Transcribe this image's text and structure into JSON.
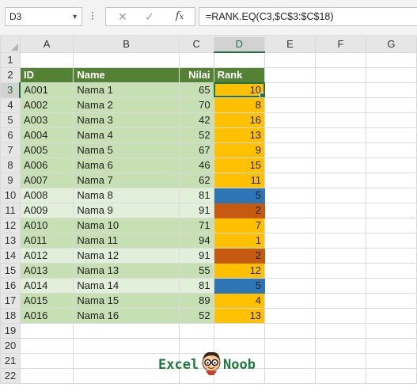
{
  "name_box": "D3",
  "formula": "=RANK.EQ(C3,$C$3:$C$18)",
  "fx_label": "fx",
  "columns": [
    "A",
    "B",
    "C",
    "D",
    "E",
    "F",
    "G"
  ],
  "active_cell": "D3",
  "table": {
    "headers": [
      "ID",
      "Name",
      "Nilai",
      "Rank"
    ],
    "rows": [
      {
        "id": "A001",
        "name": "Nama 1",
        "nilai": "65",
        "rank": "10",
        "rank_color": "yellow",
        "band": "g1"
      },
      {
        "id": "A002",
        "name": "Nama 2",
        "nilai": "70",
        "rank": "8",
        "rank_color": "yellow",
        "band": "g1"
      },
      {
        "id": "A003",
        "name": "Nama 3",
        "nilai": "42",
        "rank": "16",
        "rank_color": "yellow",
        "band": "g1"
      },
      {
        "id": "A004",
        "name": "Nama 4",
        "nilai": "52",
        "rank": "13",
        "rank_color": "yellow",
        "band": "g1"
      },
      {
        "id": "A005",
        "name": "Nama 5",
        "nilai": "67",
        "rank": "9",
        "rank_color": "yellow",
        "band": "g1"
      },
      {
        "id": "A006",
        "name": "Nama 6",
        "nilai": "46",
        "rank": "15",
        "rank_color": "yellow",
        "band": "g1"
      },
      {
        "id": "A007",
        "name": "Nama 7",
        "nilai": "62",
        "rank": "11",
        "rank_color": "yellow",
        "band": "g1"
      },
      {
        "id": "A008",
        "name": "Nama 8",
        "nilai": "81",
        "rank": "5",
        "rank_color": "blue",
        "band": "g2"
      },
      {
        "id": "A009",
        "name": "Nama 9",
        "nilai": "91",
        "rank": "2",
        "rank_color": "red",
        "band": "g2"
      },
      {
        "id": "A010",
        "name": "Nama 10",
        "nilai": "71",
        "rank": "7",
        "rank_color": "yellow",
        "band": "g1"
      },
      {
        "id": "A011",
        "name": "Nama 11",
        "nilai": "94",
        "rank": "1",
        "rank_color": "yellow",
        "band": "g1"
      },
      {
        "id": "A012",
        "name": "Nama 12",
        "nilai": "91",
        "rank": "2",
        "rank_color": "red",
        "band": "g2"
      },
      {
        "id": "A013",
        "name": "Nama 13",
        "nilai": "55",
        "rank": "12",
        "rank_color": "yellow",
        "band": "g1"
      },
      {
        "id": "A014",
        "name": "Nama 14",
        "nilai": "81",
        "rank": "5",
        "rank_color": "blue",
        "band": "g2"
      },
      {
        "id": "A015",
        "name": "Nama 15",
        "nilai": "89",
        "rank": "4",
        "rank_color": "yellow",
        "band": "g1"
      },
      {
        "id": "A016",
        "name": "Nama 16",
        "nilai": "52",
        "rank": "13",
        "rank_color": "yellow",
        "band": "g1"
      }
    ]
  },
  "row_numbers": [
    "1",
    "2",
    "3",
    "4",
    "5",
    "6",
    "7",
    "8",
    "9",
    "10",
    "11",
    "12",
    "13",
    "14",
    "15",
    "16",
    "17",
    "18",
    "19",
    "20",
    "21",
    "22"
  ],
  "logo": {
    "word1": "Excel",
    "word2": "Noob"
  },
  "colors": {
    "header_green": "#548235",
    "band_green": "#c6e0b4",
    "band_light": "#e2efda",
    "rank_yellow": "#ffc000",
    "rank_blue": "#2e75b6",
    "rank_red": "#c55a11",
    "excel_green": "#217346"
  }
}
